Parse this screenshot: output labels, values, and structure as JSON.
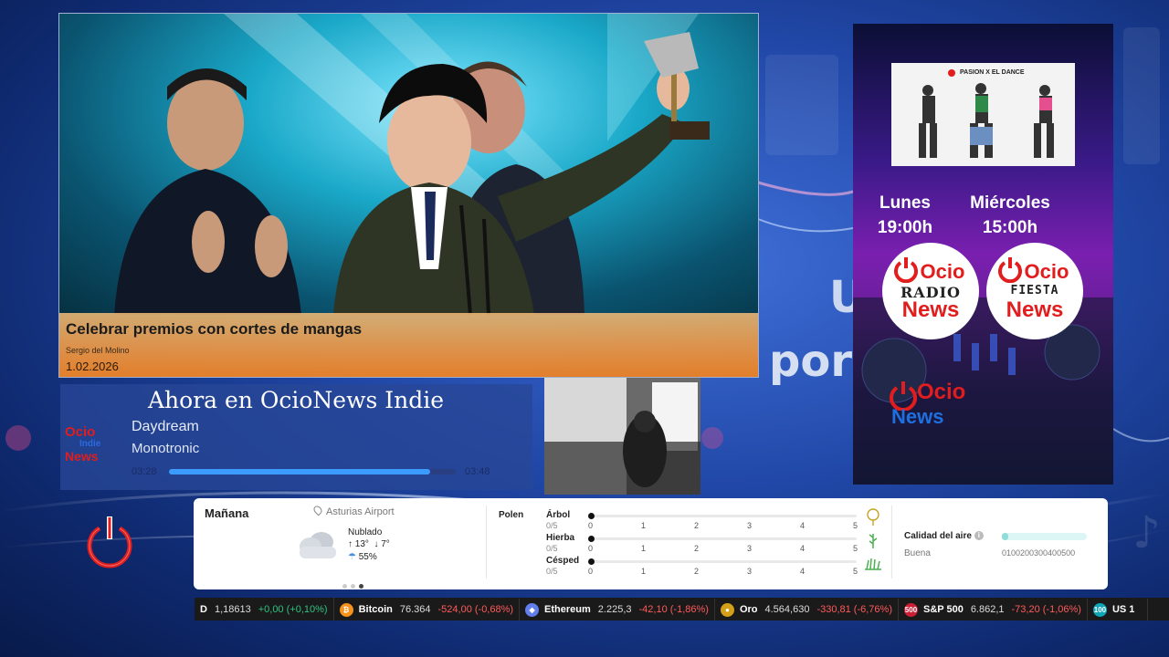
{
  "background": {
    "word1": "U",
    "word2": "por"
  },
  "news": {
    "title": "Celebrar premios con cortes de mangas",
    "author": "Sergio del Molino",
    "date": "1.02.2026",
    "watermark": "News"
  },
  "now_playing": {
    "heading": "Ahora en OcioNews Indie",
    "logo_text": [
      "Ocio",
      "Indie",
      "News"
    ],
    "track": "Daydream",
    "artist": "Monotronic",
    "elapsed": "03:28",
    "total": "03:48",
    "progress": 0.91
  },
  "promo": {
    "photo_title": "PASION X EL DANCE",
    "day1": "Lunes",
    "time1": "19:00h",
    "day2": "Miércoles",
    "time2": "15:00h",
    "badge1": {
      "top": "Ocio",
      "mid": "RADIO",
      "bottom": "News"
    },
    "badge2": {
      "top": "Ocio",
      "mid": "FIESTA",
      "bottom": "News"
    },
    "footer_logo": {
      "top": "Ocio",
      "bottom": "News"
    },
    "colors": {
      "accent": "#e11d1d",
      "news_blue": "#1e6fe0"
    }
  },
  "weather": {
    "title": "Mañana",
    "location": "Asturias Airport",
    "condition": "Nublado",
    "temp_high": "↑ 13°",
    "temp_low": "↓ 7°",
    "rain": "55%",
    "page_dots": 3,
    "active_dot": 3,
    "polen_label": "Polen",
    "pollen": [
      {
        "name": "Árbol",
        "scale": "0/5",
        "value": 0,
        "icon": "tree-pollen-icon"
      },
      {
        "name": "Hierba",
        "scale": "0/5",
        "value": 0,
        "icon": "grass-pollen-icon"
      },
      {
        "name": "Césped",
        "scale": "0/5",
        "value": 0,
        "icon": "lawn-pollen-icon"
      }
    ],
    "pollen_ticks": [
      "0",
      "1",
      "2",
      "3",
      "4",
      "5"
    ],
    "air_quality": {
      "title": "Calidad del aire",
      "info": "i",
      "level": "Buena",
      "scale": "0100200300400500",
      "value_fraction": 0.07
    }
  },
  "ticker": [
    {
      "icon": "",
      "color": "#1a1a1a",
      "name": "D",
      "price": "1,18613",
      "change": "+0,00 (+0,10%)",
      "dir": "pos"
    },
    {
      "icon": "₿",
      "color": "#f7931a",
      "name": "Bitcoin",
      "price": "76.364",
      "change": "-524,00 (-0,68%)",
      "dir": "neg"
    },
    {
      "icon": "◆",
      "color": "#627eea",
      "name": "Ethereum",
      "price": "2.225,3",
      "change": "-42,10 (-1,86%)",
      "dir": "neg"
    },
    {
      "icon": "●",
      "color": "#d4a017",
      "name": "Oro",
      "price": "4.564,630",
      "change": "-330,81 (-6,76%)",
      "dir": "neg"
    },
    {
      "icon": "500",
      "color": "#cc1f36",
      "name": "S&P 500",
      "price": "6.862,1",
      "change": "-73,20 (-1,06%)",
      "dir": "neg"
    },
    {
      "icon": "100",
      "color": "#0ea5b7",
      "name": "US 1",
      "price": "",
      "change": "",
      "dir": "neg"
    }
  ]
}
